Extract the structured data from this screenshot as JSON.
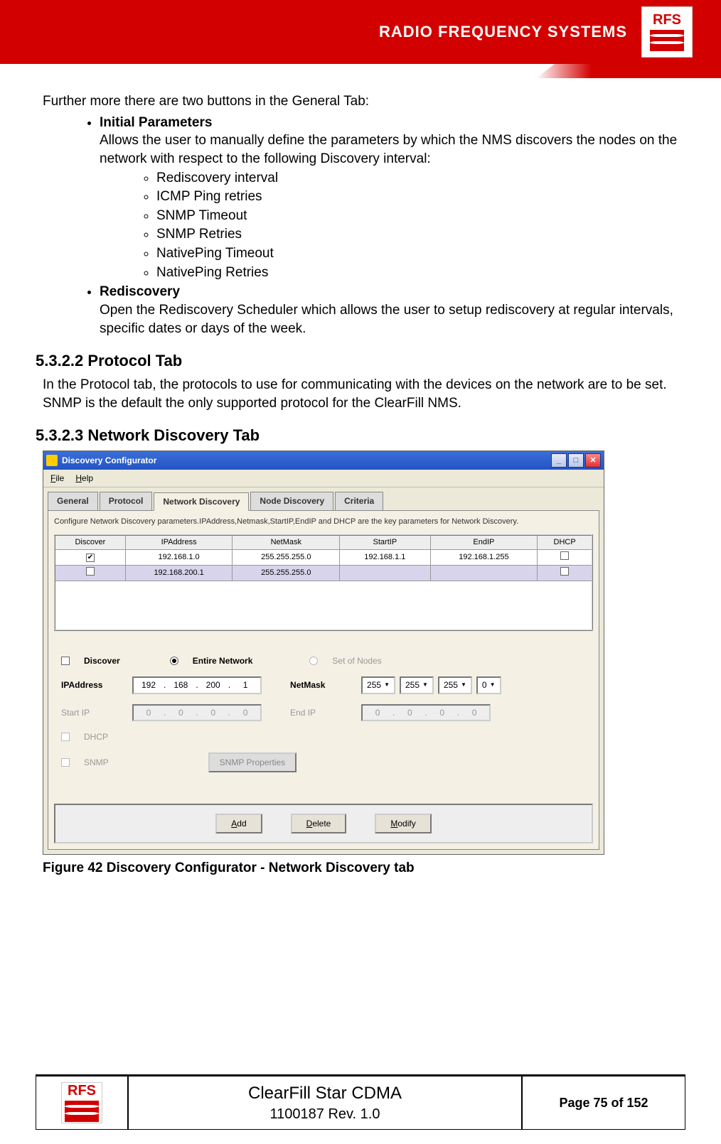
{
  "header": {
    "brand_text": "RADIO FREQUENCY SYSTEMS",
    "logo_text": "RFS"
  },
  "body": {
    "intro": "Further more there are two buttons in the General Tab:",
    "bullets": [
      {
        "title": "Initial Parameters",
        "desc": "Allows the user to manually define the parameters by which the NMS discovers the nodes on the network with respect to the following Discovery interval:",
        "sub": [
          "Rediscovery interval",
          "ICMP Ping retries",
          "SNMP Timeout",
          "SNMP Retries",
          "NativePing Timeout",
          "NativePing Retries"
        ]
      },
      {
        "title": "Rediscovery",
        "desc": "Open the Rediscovery Scheduler which allows the user to setup rediscovery at regular intervals, specific dates or days of the week."
      }
    ],
    "section_5322_title": "5.3.2.2  Protocol Tab",
    "section_5322_text": "In the Protocol tab, the protocols to use for communicating with the devices on the network are to be set. SNMP is the default the only supported protocol for the ClearFill NMS.",
    "section_5323_title": "5.3.2.3  Network Discovery Tab",
    "figure_caption": "Figure 42 Discovery Configurator - Network Discovery tab"
  },
  "window": {
    "title": "Discovery Configurator",
    "menu": {
      "file": "File",
      "help": "Help"
    },
    "tabs": [
      "General",
      "Protocol",
      "Network Discovery",
      "Node Discovery",
      "Criteria"
    ],
    "active_tab": 2,
    "panel_desc": "Configure Network Discovery parameters.IPAddress,Netmask,StartIP,EndIP and DHCP are the key parameters for Network Discovery.",
    "table": {
      "headers": [
        "Discover",
        "IPAddress",
        "NetMask",
        "StartIP",
        "EndIP",
        "DHCP"
      ],
      "rows": [
        {
          "discover": true,
          "ip": "192.168.1.0",
          "mask": "255.255.255.0",
          "startip": "192.168.1.1",
          "endip": "192.168.1.255",
          "dhcp": false
        },
        {
          "discover": false,
          "ip": "192.168.200.1",
          "mask": "255.255.255.0",
          "startip": "",
          "endip": "",
          "dhcp": false
        }
      ]
    },
    "form": {
      "discover_label": "Discover",
      "entire_network_label": "Entire Network",
      "set_of_nodes_label": "Set of Nodes",
      "ipaddress_label": "IPAddress",
      "ipaddress_value": [
        "192",
        "168",
        "200",
        "1"
      ],
      "netmask_label": "NetMask",
      "netmask_value": [
        "255",
        "255",
        "255",
        "0"
      ],
      "startip_label": "Start IP",
      "startip_value": [
        "0",
        "0",
        "0",
        "0"
      ],
      "endip_label": "End IP",
      "endip_value": [
        "0",
        "0",
        "0",
        "0"
      ],
      "dhcp_label": "DHCP",
      "snmp_label": "SNMP",
      "snmp_properties_btn": "SNMP Properties"
    },
    "buttons": {
      "add": "Add",
      "delete": "Delete",
      "modify": "Modify"
    }
  },
  "footer": {
    "logo_text": "RFS",
    "title": "ClearFill Star CDMA",
    "subtitle": "1100187 Rev. 1.0",
    "page": "Page 75 of 152"
  }
}
